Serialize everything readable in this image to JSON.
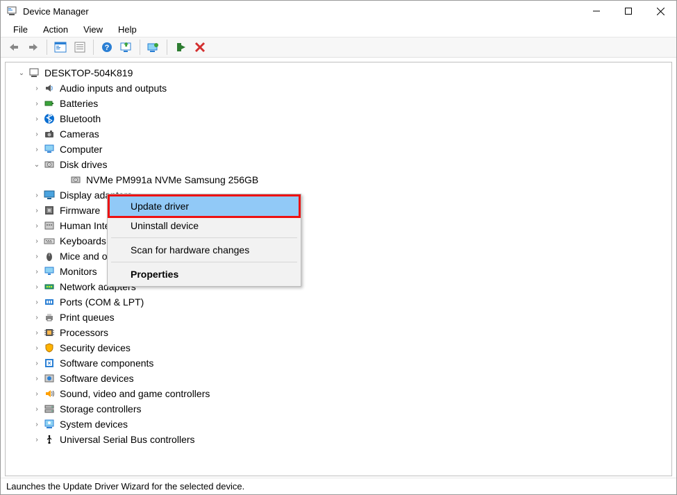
{
  "window": {
    "title": "Device Manager"
  },
  "menubar": {
    "items": [
      "File",
      "Action",
      "View",
      "Help"
    ]
  },
  "tree": {
    "root": {
      "label": "DESKTOP-504K819",
      "expanded": true
    },
    "nodes": [
      {
        "label": "Audio inputs and outputs",
        "icon": "audio",
        "expanded": false
      },
      {
        "label": "Batteries",
        "icon": "battery",
        "expanded": false
      },
      {
        "label": "Bluetooth",
        "icon": "bluetooth",
        "expanded": false
      },
      {
        "label": "Cameras",
        "icon": "camera",
        "expanded": false
      },
      {
        "label": "Computer",
        "icon": "computer",
        "expanded": false
      },
      {
        "label": "Disk drives",
        "icon": "disk",
        "expanded": true,
        "children": [
          {
            "label": "NVMe PM991a NVMe Samsung 256GB",
            "icon": "disk"
          }
        ]
      },
      {
        "label": "Display adapters",
        "icon": "display",
        "expanded": false
      },
      {
        "label": "Firmware",
        "icon": "firmware",
        "expanded": false
      },
      {
        "label": "Human Interface Devices",
        "icon": "hid",
        "expanded": false
      },
      {
        "label": "Keyboards",
        "icon": "keyboard",
        "expanded": false
      },
      {
        "label": "Mice and other pointing devices",
        "icon": "mouse",
        "expanded": false
      },
      {
        "label": "Monitors",
        "icon": "monitor",
        "expanded": false
      },
      {
        "label": "Network adapters",
        "icon": "network",
        "expanded": false
      },
      {
        "label": "Ports (COM & LPT)",
        "icon": "ports",
        "expanded": false
      },
      {
        "label": "Print queues",
        "icon": "printer",
        "expanded": false
      },
      {
        "label": "Processors",
        "icon": "cpu",
        "expanded": false
      },
      {
        "label": "Security devices",
        "icon": "security",
        "expanded": false
      },
      {
        "label": "Software components",
        "icon": "swcomp",
        "expanded": false
      },
      {
        "label": "Software devices",
        "icon": "swdev",
        "expanded": false
      },
      {
        "label": "Sound, video and game controllers",
        "icon": "sound",
        "expanded": false
      },
      {
        "label": "Storage controllers",
        "icon": "storage",
        "expanded": false
      },
      {
        "label": "System devices",
        "icon": "system",
        "expanded": false
      },
      {
        "label": "Universal Serial Bus controllers",
        "icon": "usb",
        "expanded": false
      }
    ]
  },
  "context_menu": {
    "items": [
      {
        "label": "Update driver",
        "highlight": true
      },
      {
        "label": "Uninstall device"
      },
      {
        "sep": true
      },
      {
        "label": "Scan for hardware changes"
      },
      {
        "sep": true
      },
      {
        "label": "Properties",
        "bold": true
      }
    ]
  },
  "statusbar": {
    "text": "Launches the Update Driver Wizard for the selected device."
  }
}
